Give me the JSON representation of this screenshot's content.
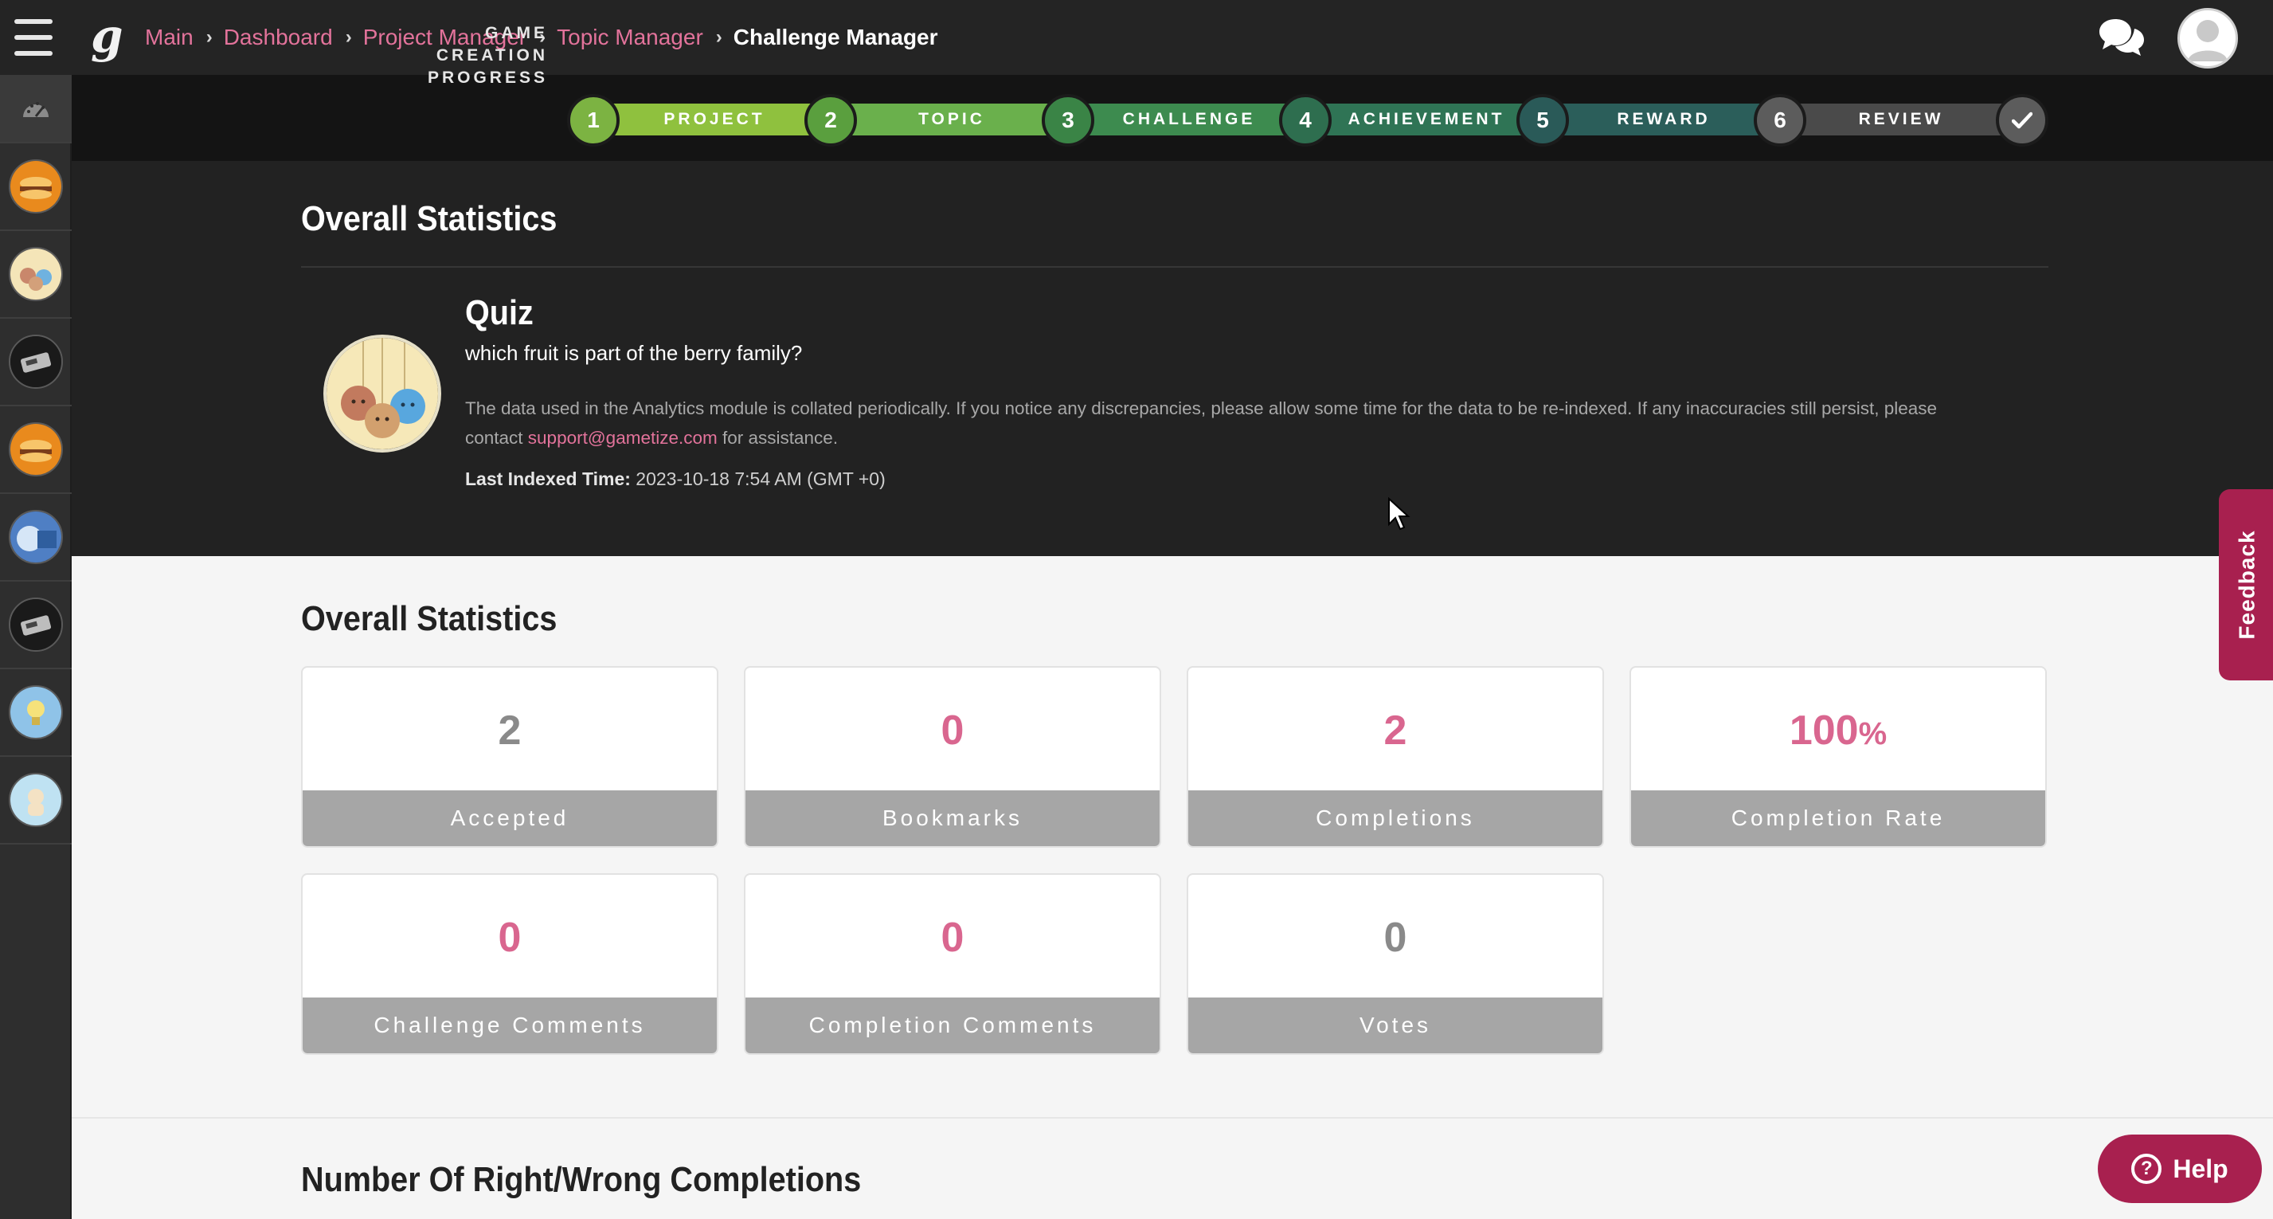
{
  "header": {
    "logo": "g",
    "breadcrumb": [
      "Main",
      "Dashboard",
      "Project Manager",
      "Topic Manager"
    ],
    "current": "Challenge Manager"
  },
  "progress": {
    "label_line1": "GAME CREATION",
    "label_line2": "PROGRESS",
    "steps": [
      {
        "num": "1",
        "label": "PROJECT",
        "color": "#8fc13e",
        "circle": "#7cb342"
      },
      {
        "num": "2",
        "label": "TOPIC",
        "color": "#6ab04c",
        "circle": "#5a9f3e"
      },
      {
        "num": "3",
        "label": "CHALLENGE",
        "color": "#3d8b4f",
        "circle": "#3a8446"
      },
      {
        "num": "4",
        "label": "ACHIEVEMENT",
        "color": "#2f7455",
        "circle": "#2e6e4f"
      },
      {
        "num": "5",
        "label": "REWARD",
        "color": "#2b5e5a",
        "circle": "#2a5a58"
      },
      {
        "num": "6",
        "label": "REVIEW",
        "color": "#4a4a4a",
        "circle": "#5c5c5c"
      }
    ],
    "final_icon": "checkmark-icon"
  },
  "overview": {
    "title": "Overall Statistics",
    "quiz_title": "Quiz",
    "question": "which fruit is part of the berry family?",
    "info_before": "The data used in the Analytics module is collated periodically. If you notice any discrepancies, please allow some time for the data to be re-indexed. If any inaccuracies still persist, please contact ",
    "info_link": "support@gametize.com",
    "info_after": " for assistance.",
    "indexed_label": "Last Indexed Time:",
    "indexed_value": " 2023-10-18 7:54 AM (GMT +0)"
  },
  "stats": {
    "title": "Overall Statistics",
    "cards": [
      {
        "value": "2",
        "unit": "",
        "label": "Accepted",
        "color": "#8a8a8a"
      },
      {
        "value": "0",
        "unit": "",
        "label": "Bookmarks",
        "color": "#d9668f"
      },
      {
        "value": "2",
        "unit": "",
        "label": "Completions",
        "color": "#d9668f"
      },
      {
        "value": "100",
        "unit": "%",
        "label": "Completion Rate",
        "color": "#d9668f"
      },
      {
        "value": "0",
        "unit": "",
        "label": "Challenge Comments",
        "color": "#d9668f"
      },
      {
        "value": "0",
        "unit": "",
        "label": "Completion Comments",
        "color": "#d9668f"
      },
      {
        "value": "0",
        "unit": "",
        "label": "Votes",
        "color": "#8a8a8a"
      }
    ]
  },
  "bottom_title": "Number Of Right/Wrong Completions",
  "feedback_label": "Feedback",
  "help_label": "Help",
  "colors": {
    "accent": "#e3739b",
    "brand": "#a8204f"
  }
}
